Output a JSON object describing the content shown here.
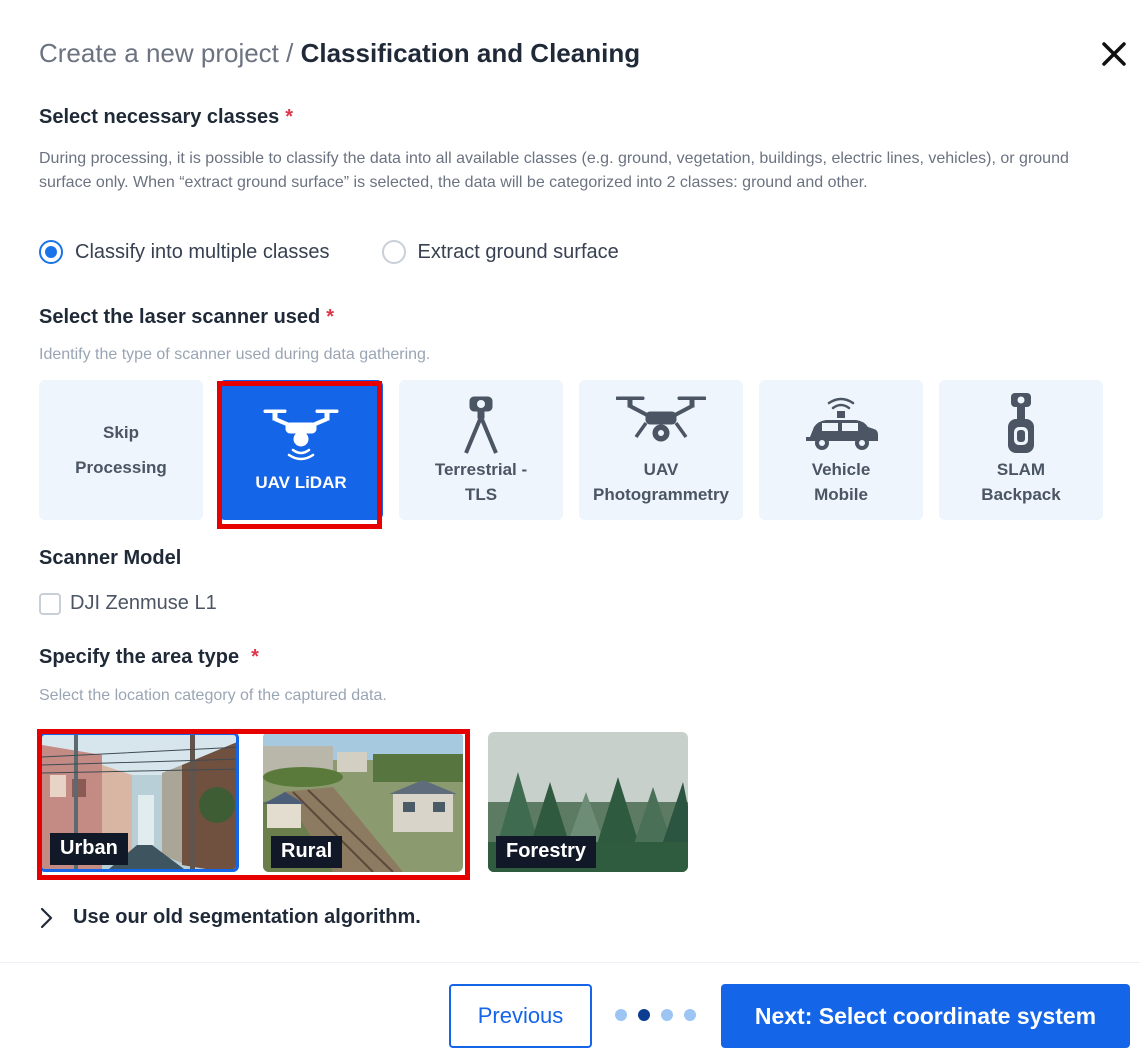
{
  "header": {
    "breadcrumb": "Create a new project / ",
    "title": "Classification and Cleaning"
  },
  "classes_section": {
    "title": "Select necessary classes",
    "required_mark": "*",
    "description": "During processing, it is possible to classify the data into all available classes (e.g. ground, vegetation, buildings, electric lines, vehicles), or ground surface only. When “extract ground surface” is selected, the data will be categorized into 2 classes: ground and other.",
    "options": [
      {
        "label": "Classify into multiple classes",
        "selected": true
      },
      {
        "label": "Extract ground surface",
        "selected": false
      }
    ]
  },
  "scanner_section": {
    "title": "Select the laser scanner used",
    "required_mark": "*",
    "hint": "Identify the type of scanner used during data gathering.",
    "cards": [
      {
        "line1": "Skip",
        "line2": "Processing",
        "icon": "none",
        "selected": false
      },
      {
        "line1": "UAV LiDAR",
        "line2": "",
        "icon": "drone-lidar-icon",
        "selected": true
      },
      {
        "line1": "Terrestrial -",
        "line2": "TLS",
        "icon": "tripod-scanner-icon",
        "selected": false
      },
      {
        "line1": "UAV",
        "line2": "Photogrammetry",
        "icon": "drone-camera-icon",
        "selected": false
      },
      {
        "line1": "Vehicle",
        "line2": "Mobile",
        "icon": "car-scanner-icon",
        "selected": false
      },
      {
        "line1": "SLAM",
        "line2": "Backpack",
        "icon": "backpack-scanner-icon",
        "selected": false
      }
    ]
  },
  "scanner_model": {
    "title": "Scanner Model",
    "checkbox_label": "DJI Zenmuse L1",
    "checked": false
  },
  "area_section": {
    "title": "Specify the area type",
    "required_mark": "*",
    "hint": "Select the location category of the captured data.",
    "areas": [
      {
        "label": "Urban",
        "selected": true
      },
      {
        "label": "Rural",
        "selected": false
      },
      {
        "label": "Forestry",
        "selected": false
      }
    ]
  },
  "old_algorithm": {
    "label": "Use our old segmentation algorithm."
  },
  "footer": {
    "previous_label": "Previous",
    "next_label": "Next: Select coordinate system",
    "step_count": 4,
    "active_step": 2
  },
  "colors": {
    "accent": "#1565e8",
    "required": "#e0344b",
    "highlight_box": "#e60000"
  }
}
